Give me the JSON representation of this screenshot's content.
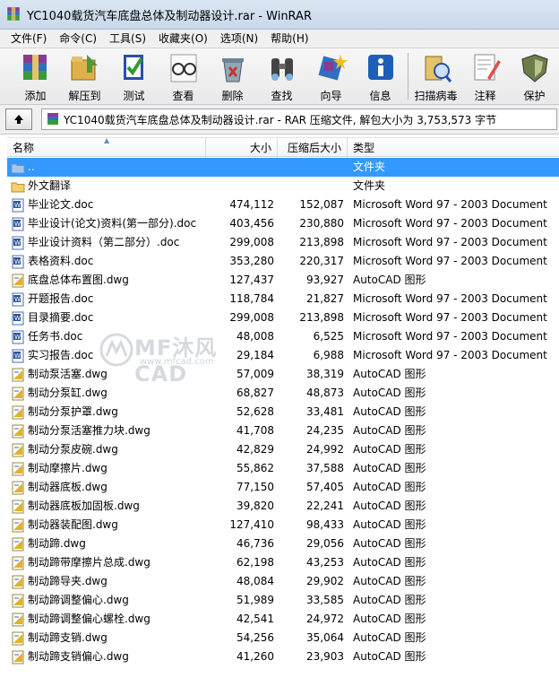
{
  "window": {
    "title": "YC1040载货汽车底盘总体及制动器设计.rar - WinRAR"
  },
  "menu": [
    "文件(F)",
    "命令(C)",
    "工具(S)",
    "收藏夹(O)",
    "选项(N)",
    "帮助(H)"
  ],
  "toolbar": {
    "add": "添加",
    "extract": "解压到",
    "test": "测试",
    "view": "查看",
    "delete": "删除",
    "find": "查找",
    "wizard": "向导",
    "info": "信息",
    "virus": "扫描病毒",
    "comment": "注释",
    "protect": "保护"
  },
  "path": {
    "text": "YC1040载货汽车底盘总体及制动器设计.rar - RAR 压缩文件, 解包大小为 3,753,573 字节"
  },
  "columns": {
    "name": "名称",
    "size": "大小",
    "packed": "压缩后大小",
    "type": "类型"
  },
  "files": [
    {
      "name": "..",
      "size": "",
      "packed": "",
      "type": "文件夹",
      "icon": "folder-up",
      "selected": true
    },
    {
      "name": "外文翻译",
      "size": "",
      "packed": "",
      "type": "文件夹",
      "icon": "folder"
    },
    {
      "name": "毕业论文.doc",
      "size": "474,112",
      "packed": "152,087",
      "type": "Microsoft Word 97 - 2003 Document",
      "icon": "word"
    },
    {
      "name": "毕业设计(论文)资料(第一部分).doc",
      "size": "403,456",
      "packed": "230,880",
      "type": "Microsoft Word 97 - 2003 Document",
      "icon": "word"
    },
    {
      "name": "毕业设计资料（第二部分）.doc",
      "size": "299,008",
      "packed": "213,898",
      "type": "Microsoft Word 97 - 2003 Document",
      "icon": "word"
    },
    {
      "name": "表格资料.doc",
      "size": "353,280",
      "packed": "220,317",
      "type": "Microsoft Word 97 - 2003 Document",
      "icon": "word"
    },
    {
      "name": "底盘总体布置图.dwg",
      "size": "127,437",
      "packed": "93,927",
      "type": "AutoCAD 图形",
      "icon": "cad"
    },
    {
      "name": "开题报告.doc",
      "size": "118,784",
      "packed": "21,827",
      "type": "Microsoft Word 97 - 2003 Document",
      "icon": "word"
    },
    {
      "name": "目录摘要.doc",
      "size": "299,008",
      "packed": "213,898",
      "type": "Microsoft Word 97 - 2003 Document",
      "icon": "word"
    },
    {
      "name": "任务书.doc",
      "size": "48,008",
      "packed": "6,525",
      "type": "Microsoft Word 97 - 2003 Document",
      "icon": "word"
    },
    {
      "name": "实习报告.doc",
      "size": "29,184",
      "packed": "6,988",
      "type": "Microsoft Word 97 - 2003 Document",
      "icon": "word"
    },
    {
      "name": "制动泵活塞.dwg",
      "size": "57,009",
      "packed": "38,319",
      "type": "AutoCAD 图形",
      "icon": "cad"
    },
    {
      "name": "制动分泵缸.dwg",
      "size": "68,827",
      "packed": "48,873",
      "type": "AutoCAD 图形",
      "icon": "cad"
    },
    {
      "name": "制动分泵护罩.dwg",
      "size": "52,628",
      "packed": "33,481",
      "type": "AutoCAD 图形",
      "icon": "cad"
    },
    {
      "name": "制动分泵活塞推力块.dwg",
      "size": "41,708",
      "packed": "24,235",
      "type": "AutoCAD 图形",
      "icon": "cad"
    },
    {
      "name": "制动分泵皮碗.dwg",
      "size": "42,829",
      "packed": "24,992",
      "type": "AutoCAD 图形",
      "icon": "cad"
    },
    {
      "name": "制动摩擦片.dwg",
      "size": "55,862",
      "packed": "37,588",
      "type": "AutoCAD 图形",
      "icon": "cad"
    },
    {
      "name": "制动器底板.dwg",
      "size": "77,150",
      "packed": "57,405",
      "type": "AutoCAD 图形",
      "icon": "cad"
    },
    {
      "name": "制动器底板加固板.dwg",
      "size": "39,820",
      "packed": "22,241",
      "type": "AutoCAD 图形",
      "icon": "cad"
    },
    {
      "name": "制动器装配图.dwg",
      "size": "127,410",
      "packed": "98,433",
      "type": "AutoCAD 图形",
      "icon": "cad"
    },
    {
      "name": "制动蹄.dwg",
      "size": "46,736",
      "packed": "29,056",
      "type": "AutoCAD 图形",
      "icon": "cad"
    },
    {
      "name": "制动蹄带摩擦片总成.dwg",
      "size": "62,198",
      "packed": "43,253",
      "type": "AutoCAD 图形",
      "icon": "cad"
    },
    {
      "name": "制动蹄导夹.dwg",
      "size": "48,084",
      "packed": "29,902",
      "type": "AutoCAD 图形",
      "icon": "cad"
    },
    {
      "name": "制动蹄调整偏心.dwg",
      "size": "51,989",
      "packed": "33,585",
      "type": "AutoCAD 图形",
      "icon": "cad"
    },
    {
      "name": "制动蹄调整偏心螺栓.dwg",
      "size": "42,541",
      "packed": "24,972",
      "type": "AutoCAD 图形",
      "icon": "cad"
    },
    {
      "name": "制动蹄支销.dwg",
      "size": "54,256",
      "packed": "35,064",
      "type": "AutoCAD 图形",
      "icon": "cad"
    },
    {
      "name": "制动蹄支销偏心.dwg",
      "size": "41,260",
      "packed": "23,903",
      "type": "AutoCAD 图形",
      "icon": "cad"
    }
  ],
  "watermark": {
    "brand": "MF沐风CAD",
    "url": "www.mfcad.com"
  },
  "colors": {
    "selection": "#3399ff",
    "title_bg": "#dbe6f3"
  }
}
